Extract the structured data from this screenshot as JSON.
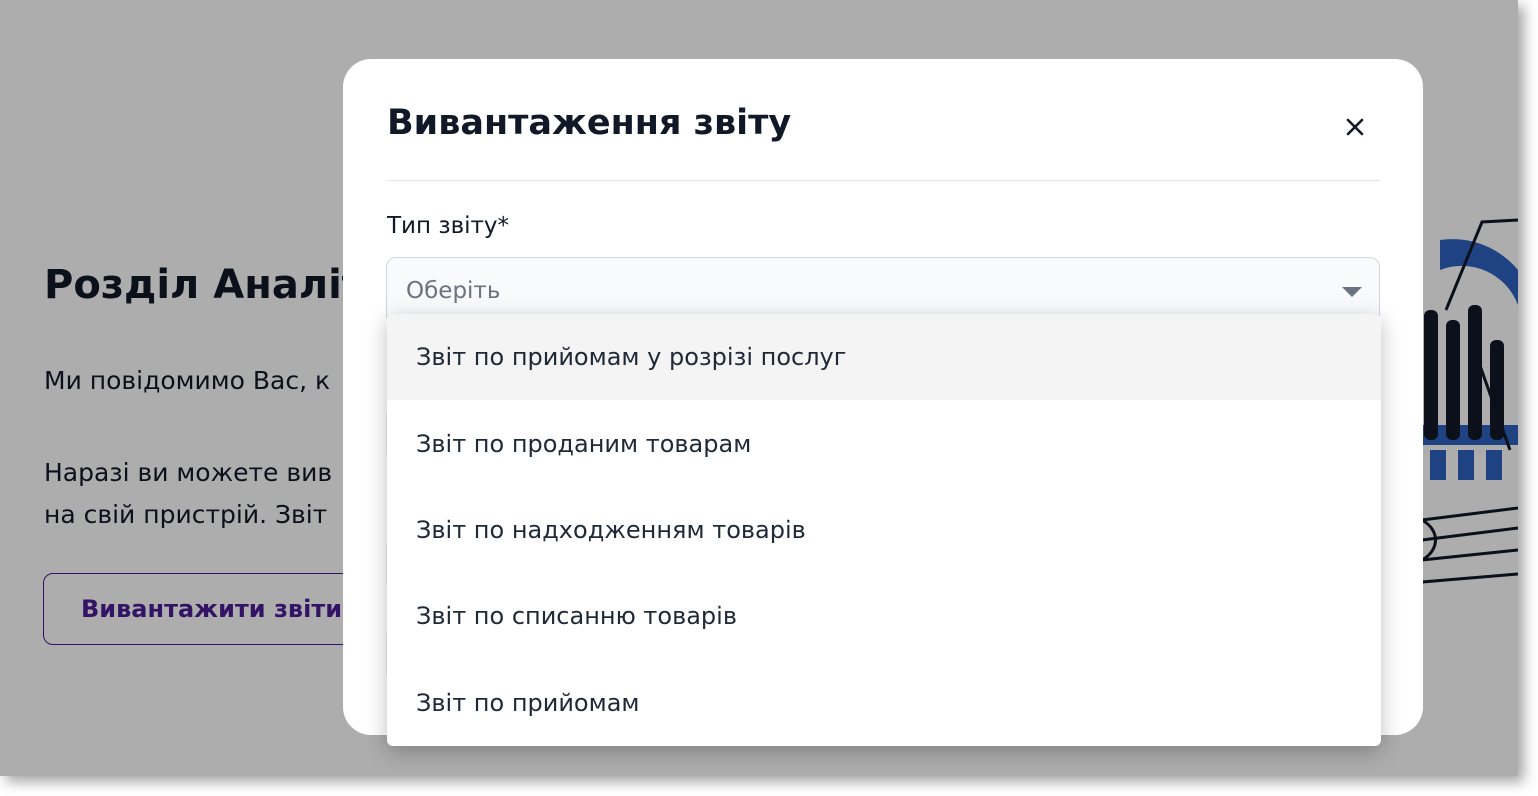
{
  "background": {
    "title": "Розділ Аналіт",
    "paragraph_1": "Ми повідомимо Вас, к",
    "paragraph_2_line_1": "Наразі ви можете вив",
    "paragraph_2_line_2": "на свій пристрій. Звіт",
    "export_button_label": "Вивантажити звіти"
  },
  "modal": {
    "title": "Вивантаження звіту",
    "close_icon": "close-icon",
    "report_type": {
      "label": "Тип звіту*",
      "placeholder": "Оберіть",
      "options": [
        "Звіт по прийомам у розрізі послуг",
        "Звіт по проданим товарам",
        "Звіт по надходженням товарів",
        "Звіт по списанню товарів",
        "Звіт по прийомам"
      ],
      "hovered_index": 0
    }
  },
  "colors": {
    "primary": "#4c1d95",
    "illustration_blue": "#2f63c0",
    "text": "#111827"
  }
}
